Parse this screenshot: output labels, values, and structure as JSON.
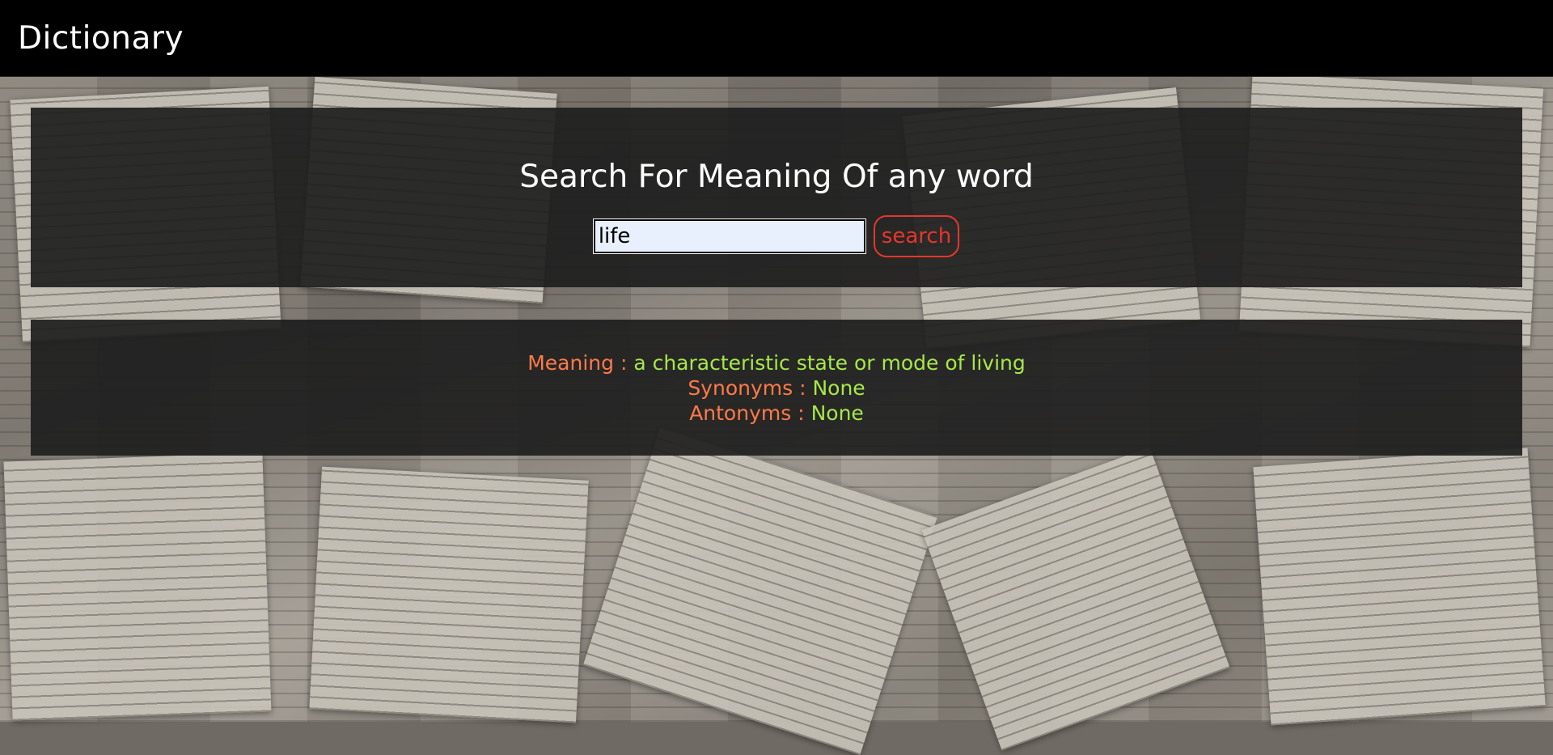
{
  "app": {
    "title": "Dictionary"
  },
  "search": {
    "heading": "Search For Meaning Of any word",
    "input_value": "life",
    "button_label": "search"
  },
  "result": {
    "meaning_label": "Meaning : ",
    "meaning_value": "a characteristic state or mode of living",
    "synonyms_label": "Synonyms : ",
    "synonyms_value": "None",
    "antonyms_label": "Antonyms : ",
    "antonyms_value": "None"
  },
  "colors": {
    "navbar": "#000000",
    "panel": "#1e1e1e",
    "label": "#ff7a4a",
    "value": "#a6e84a",
    "button_accent": "#e8362c"
  }
}
